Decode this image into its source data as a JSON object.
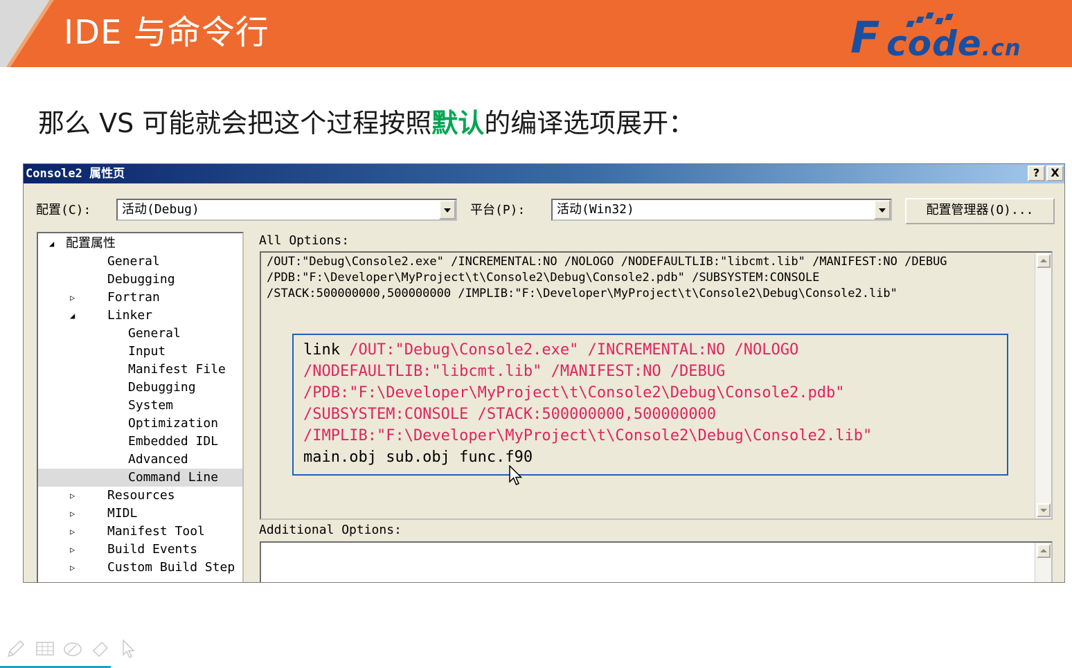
{
  "slide": {
    "title": "IDE 与命令行",
    "subtitle_pre": "那么 VS  可能就会把这个过程按照",
    "subtitle_highlight": "默认",
    "subtitle_post": "的编译选项展开：",
    "highlight_color": "#00a651",
    "header_color": "#ee6a2e"
  },
  "logo": {
    "f": "F",
    "text": "code",
    "tld": ".cn",
    "color": "#1a4fa0"
  },
  "dialog": {
    "title": "Console2 属性页",
    "help_btn": "?",
    "close_btn": "X",
    "config_label": "配置(C):",
    "config_value": "活动(Debug)",
    "platform_label": "平台(P):",
    "platform_value": "活动(Win32)",
    "config_manager_btn": "配置管理器(O)...",
    "tree": [
      {
        "label": "配置属性",
        "expander": "◢"
      },
      {
        "label": "General",
        "expander": ""
      },
      {
        "label": "Debugging",
        "expander": ""
      },
      {
        "label": "Fortran",
        "expander": "▷"
      },
      {
        "label": "Linker",
        "expander": "◢"
      },
      {
        "label": "General",
        "expander": ""
      },
      {
        "label": "Input",
        "expander": ""
      },
      {
        "label": "Manifest File",
        "expander": ""
      },
      {
        "label": "Debugging",
        "expander": ""
      },
      {
        "label": "System",
        "expander": ""
      },
      {
        "label": "Optimization",
        "expander": ""
      },
      {
        "label": "Embedded IDL",
        "expander": ""
      },
      {
        "label": "Advanced",
        "expander": ""
      },
      {
        "label": "Command Line",
        "expander": "",
        "selected": true
      },
      {
        "label": "Resources",
        "expander": "▷"
      },
      {
        "label": "MIDL",
        "expander": "▷"
      },
      {
        "label": "Manifest Tool",
        "expander": "▷"
      },
      {
        "label": "Build Events",
        "expander": "▷"
      },
      {
        "label": "Custom Build Step",
        "expander": "▷"
      }
    ],
    "all_options_label": "All Options:",
    "all_options_lines": [
      "/OUT:\"Debug\\Console2.exe\" /INCREMENTAL:NO /NOLOGO /NODEFAULTLIB:\"libcmt.lib\" /MANIFEST:NO /DEBUG",
      "/PDB:\"F:\\Developer\\MyProject\\t\\Console2\\Debug\\Console2.pdb\" /SUBSYSTEM:CONSOLE",
      "/STACK:500000000,500000000 /IMPLIB:\"F:\\Developer\\MyProject\\t\\Console2\\Debug\\Console2.lib\""
    ],
    "command": {
      "link_word": "link",
      "line1_rest": " /OUT:\"Debug\\Console2.exe\" /INCREMENTAL:NO /NOLOGO",
      "line2": "/NODEFAULTLIB:\"libcmt.lib\" /MANIFEST:NO /DEBUG",
      "line3": "/PDB:\"F:\\Developer\\MyProject\\t\\Console2\\Debug\\Console2.pdb\"",
      "line4": "/SUBSYSTEM:CONSOLE /STACK:500000000,500000000",
      "line5": "/IMPLIB:\"F:\\Developer\\MyProject\\t\\Console2\\Debug\\Console2.lib\"",
      "line6": "main.obj sub.obj func.f90"
    },
    "additional_options_label": "Additional Options:",
    "additional_options_value": ""
  },
  "toolbar_icons": [
    "pen-icon",
    "grid-icon",
    "eraser-ellipse-icon",
    "eraser-icon",
    "pointer-icon"
  ]
}
